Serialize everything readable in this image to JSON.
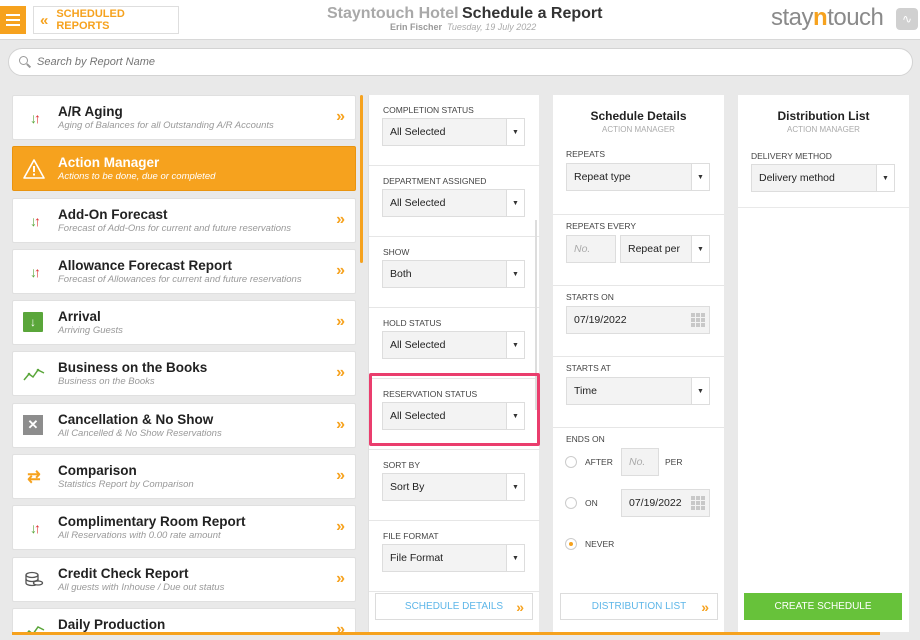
{
  "header": {
    "back_label": "SCHEDULED REPORTS",
    "hotel_name": "Stayntouch Hotel",
    "page_title": "Schedule a Report",
    "user": "Erin Fischer",
    "date": "Tuesday, 19 July 2022",
    "logo_pre": "stay",
    "logo_n": "n",
    "logo_post": "touch"
  },
  "search": {
    "placeholder": "Search by Report Name"
  },
  "reports": [
    {
      "name": "A/R Aging",
      "desc": "Aging of Balances for all Outstanding A/R Accounts",
      "icon": "arrows-icon"
    },
    {
      "name": "Action Manager",
      "desc": "Actions to be done, due or completed",
      "icon": "warning-icon"
    },
    {
      "name": "Add-On Forecast",
      "desc": "Forecast of Add-Ons for current and future reservations",
      "icon": "arrows-icon"
    },
    {
      "name": "Allowance Forecast Report",
      "desc": "Forecast of Allowances for current and future reservations",
      "icon": "arrows-icon"
    },
    {
      "name": "Arrival",
      "desc": "Arriving Guests",
      "icon": "arrival-icon"
    },
    {
      "name": "Business on the Books",
      "desc": "Business on the Books",
      "icon": "trend-icon"
    },
    {
      "name": "Cancellation & No Show",
      "desc": "All Cancelled & No Show Reservations",
      "icon": "cancel-icon"
    },
    {
      "name": "Comparison",
      "desc": "Statistics Report by Comparison",
      "icon": "swap-icon"
    },
    {
      "name": "Complimentary Room Report",
      "desc": "All Reservations with 0.00 rate amount",
      "icon": "arrows-icon"
    },
    {
      "name": "Credit Check Report",
      "desc": "All guests with Inhouse / Due out status",
      "icon": "coins-icon"
    },
    {
      "name": "Daily Production",
      "desc": "",
      "icon": "trend-icon"
    }
  ],
  "filters": [
    {
      "label": "COMPLETION STATUS",
      "value": "All Selected"
    },
    {
      "label": "DEPARTMENT ASSIGNED",
      "value": "All Selected"
    },
    {
      "label": "SHOW",
      "value": "Both"
    },
    {
      "label": "HOLD STATUS",
      "value": "All Selected"
    },
    {
      "label": "RESERVATION STATUS",
      "value": "All Selected"
    },
    {
      "label": "SORT BY",
      "value": "Sort By"
    },
    {
      "label": "FILE FORMAT",
      "value": "File Format"
    }
  ],
  "schedule": {
    "title": "Schedule Details",
    "subtitle": "ACTION MANAGER",
    "repeats_label": "REPEATS",
    "repeats_value": "Repeat type",
    "repeats_every_label": "REPEATS EVERY",
    "repeats_every_no": "No.",
    "repeats_every_per": "Repeat per",
    "starts_on_label": "STARTS ON",
    "starts_on_value": "07/19/2022",
    "starts_at_label": "STARTS AT",
    "starts_at_value": "Time",
    "ends_on_label": "ENDS ON",
    "after_label": "AFTER",
    "after_no": "No.",
    "per_label": "PER",
    "on_label": "ON",
    "on_value": "07/19/2022",
    "never_label": "NEVER"
  },
  "distribution": {
    "title": "Distribution List",
    "subtitle": "ACTION MANAGER",
    "method_label": "DELIVERY METHOD",
    "method_value": "Delivery method"
  },
  "buttons": {
    "schedule_details": "SCHEDULE DETAILS",
    "distribution_list": "DISTRIBUTION LIST",
    "create_schedule": "CREATE SCHEDULE"
  },
  "colors": {
    "accent": "#f6a21e",
    "highlight": "#ea3d6d",
    "create": "#67c23a",
    "link": "#5db6e8"
  }
}
